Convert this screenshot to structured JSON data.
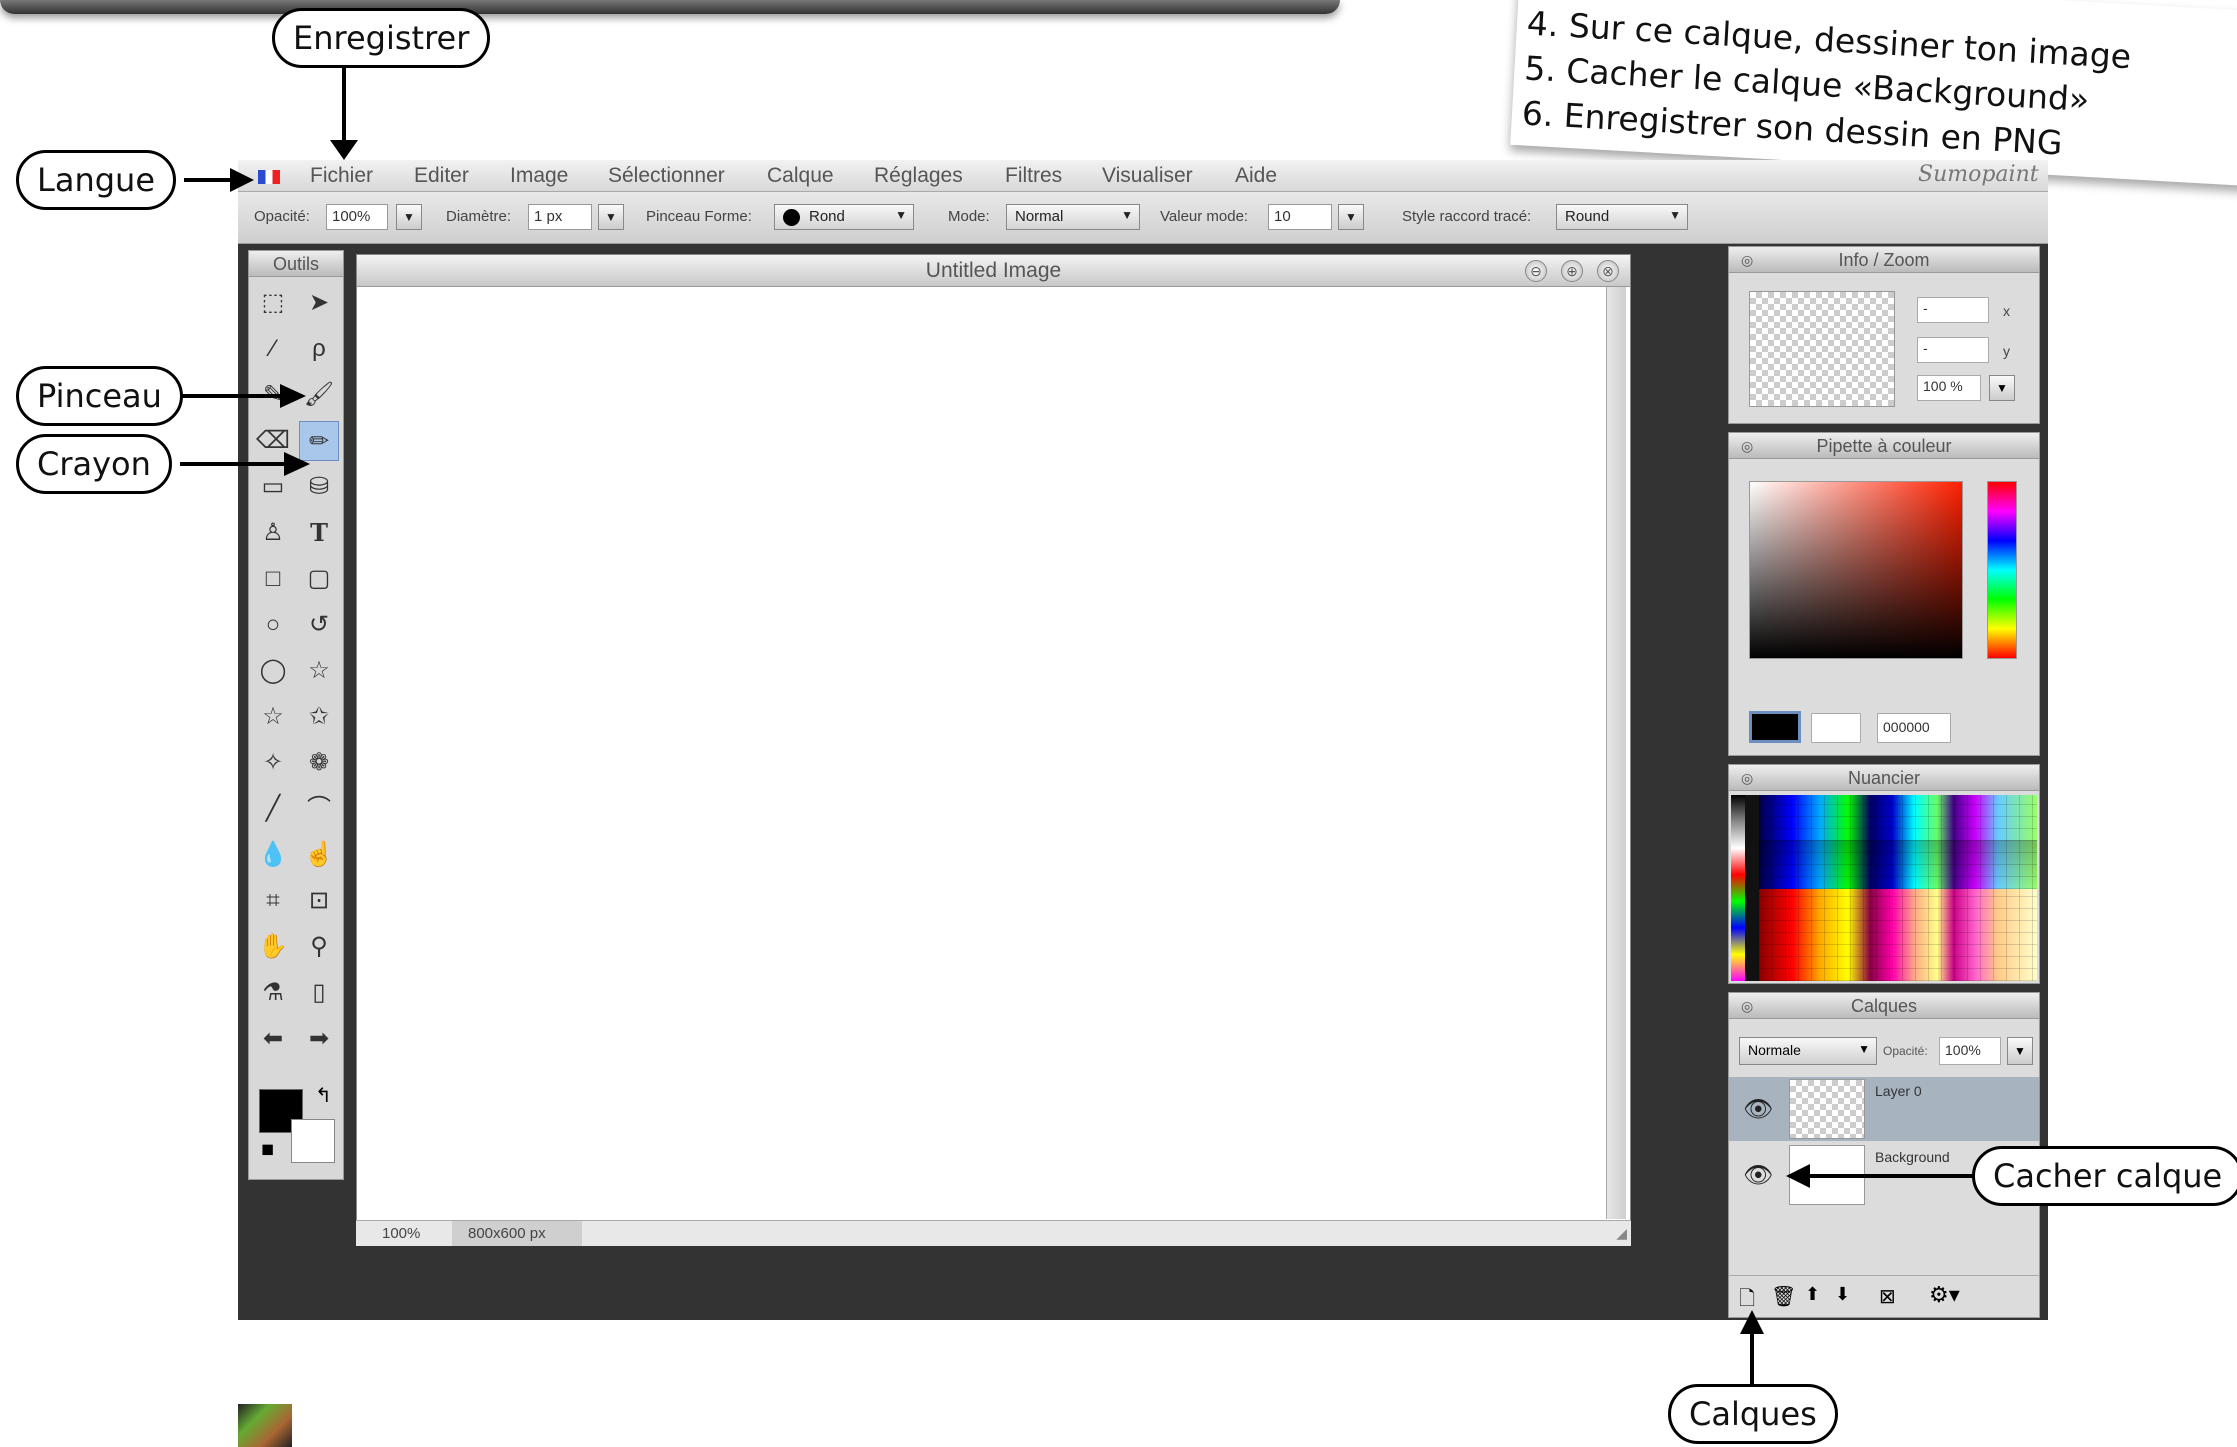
{
  "note": {
    "lines": [
      "4. Sur ce calque, dessiner ton image",
      "5. Cacher le calque «Background»",
      "6. Enregistrer son dessin en PNG"
    ]
  },
  "callouts": {
    "enregistrer": "Enregistrer",
    "langue": "Langue",
    "pinceau": "Pinceau",
    "crayon": "Crayon",
    "cacher_calque": "Cacher calque",
    "calques": "Calques"
  },
  "menubar": {
    "items": [
      "Fichier",
      "Editer",
      "Image",
      "Sélectionner",
      "Calque",
      "Réglages",
      "Filtres",
      "Visualiser",
      "Aide"
    ],
    "logo": "Sumopaint"
  },
  "options": {
    "opacity_label": "Opacité:",
    "opacity_value": "100%",
    "diameter_label": "Diamètre:",
    "diameter_value": "1 px",
    "brush_shape_label": "Pinceau Forme:",
    "brush_shape_value": "Rond",
    "mode_label": "Mode:",
    "mode_value": "Normal",
    "mode_value_label": "Valeur mode:",
    "mode_value_value": "10",
    "join_style_label": "Style raccord tracé:",
    "join_style_value": "Round"
  },
  "tools": {
    "title": "Outils"
  },
  "document": {
    "title": "Untitled Image",
    "zoom": "100%",
    "size": "800x600 px"
  },
  "info_zoom": {
    "title": "Info / Zoom",
    "x_value": "-",
    "x_label": "x",
    "y_value": "-",
    "y_label": "y",
    "zoom_value": "100 %"
  },
  "color_picker": {
    "title": "Pipette à couleur",
    "hex": "000000"
  },
  "swatches": {
    "title": "Nuancier"
  },
  "layers": {
    "title": "Calques",
    "blend_mode": "Normale",
    "opacity_label": "Opacité:",
    "opacity_value": "100%",
    "items": [
      "Layer 0",
      "Background"
    ]
  }
}
